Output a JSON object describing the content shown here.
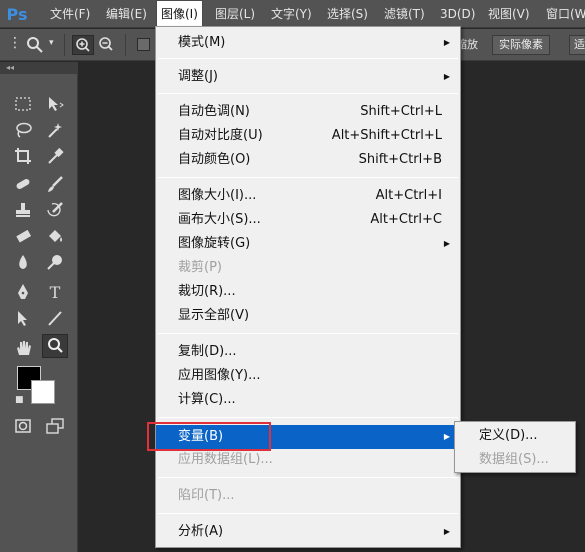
{
  "app": {
    "logo": "Ps"
  },
  "menubar": {
    "items": [
      {
        "label": "文件(F)"
      },
      {
        "label": "编辑(E)"
      },
      {
        "label": "图像(I)"
      },
      {
        "label": "图层(L)"
      },
      {
        "label": "文字(Y)"
      },
      {
        "label": "选择(S)"
      },
      {
        "label": "滤镜(T)"
      },
      {
        "label": "3D(D)"
      },
      {
        "label": "视图(V)"
      },
      {
        "label": "窗口(W"
      }
    ]
  },
  "options": {
    "partial_label": "缩放",
    "actual_pixels_button": "实际像素",
    "fit_screen_button": "适"
  },
  "toolbox": {
    "collapse_label": "◂◂"
  },
  "image_menu": {
    "mode": {
      "label": "模式(M)"
    },
    "adjustments": {
      "label": "调整(J)"
    },
    "auto_tone": {
      "label": "自动色调(N)",
      "shortcut": "Shift+Ctrl+L"
    },
    "auto_contrast": {
      "label": "自动对比度(U)",
      "shortcut": "Alt+Shift+Ctrl+L"
    },
    "auto_color": {
      "label": "自动颜色(O)",
      "shortcut": "Shift+Ctrl+B"
    },
    "image_size": {
      "label": "图像大小(I)...",
      "shortcut": "Alt+Ctrl+I"
    },
    "canvas_size": {
      "label": "画布大小(S)...",
      "shortcut": "Alt+Ctrl+C"
    },
    "image_rotation": {
      "label": "图像旋转(G)"
    },
    "crop": {
      "label": "裁剪(P)"
    },
    "trim": {
      "label": "裁切(R)..."
    },
    "reveal_all": {
      "label": "显示全部(V)"
    },
    "duplicate": {
      "label": "复制(D)..."
    },
    "apply_image": {
      "label": "应用图像(Y)..."
    },
    "calculations": {
      "label": "计算(C)..."
    },
    "variables": {
      "label": "变量(B)"
    },
    "apply_data_set": {
      "label": "应用数据组(L)..."
    },
    "trap": {
      "label": "陷印(T)..."
    },
    "analysis": {
      "label": "分析(A)"
    }
  },
  "variables_submenu": {
    "define": {
      "label": "定义(D)..."
    },
    "data_sets": {
      "label": "数据组(S)..."
    }
  },
  "colors": {
    "highlight": "#0a64c8",
    "annotation_box": "#e0303a"
  }
}
